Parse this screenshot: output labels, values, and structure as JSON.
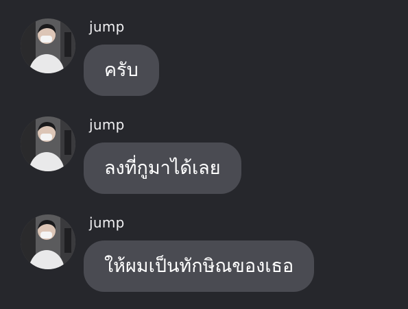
{
  "messages": [
    {
      "sender": "jump",
      "text": "ครับ"
    },
    {
      "sender": "jump",
      "text": "ลงที่กูมาได้เลย"
    },
    {
      "sender": "jump",
      "text": "ให้ผมเป็นทักษิณของเธอ"
    }
  ]
}
